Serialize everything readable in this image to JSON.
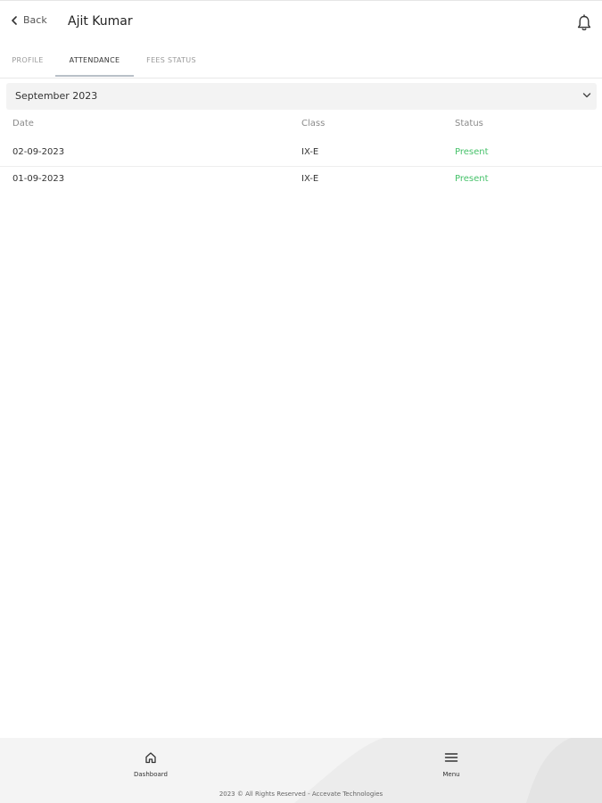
{
  "header": {
    "back_label": "Back",
    "title": "Ajit Kumar"
  },
  "tabs": [
    {
      "label": "PROFILE",
      "active": false
    },
    {
      "label": "ATTENDANCE",
      "active": true
    },
    {
      "label": "FEES STATUS",
      "active": false
    }
  ],
  "month_select": {
    "value": "September 2023"
  },
  "attendance_table": {
    "columns": [
      "Date",
      "Class",
      "Status"
    ],
    "rows": [
      {
        "date": "02-09-2023",
        "class": "IX-E",
        "status": "Present"
      },
      {
        "date": "01-09-2023",
        "class": "IX-E",
        "status": "Present"
      }
    ]
  },
  "bottom_nav": {
    "items": [
      {
        "label": "Dashboard",
        "icon": "home-icon"
      },
      {
        "label": "Menu",
        "icon": "menu-icon"
      }
    ]
  },
  "footer": {
    "text": "2023 © All Rights Reserved - Accevate Technologies"
  },
  "colors": {
    "present": "#46c26a",
    "tab_active_underline": "#b9c0c8",
    "select_bg": "#f3f3f3",
    "bottom_bar_bg": "#f4f4f4"
  }
}
